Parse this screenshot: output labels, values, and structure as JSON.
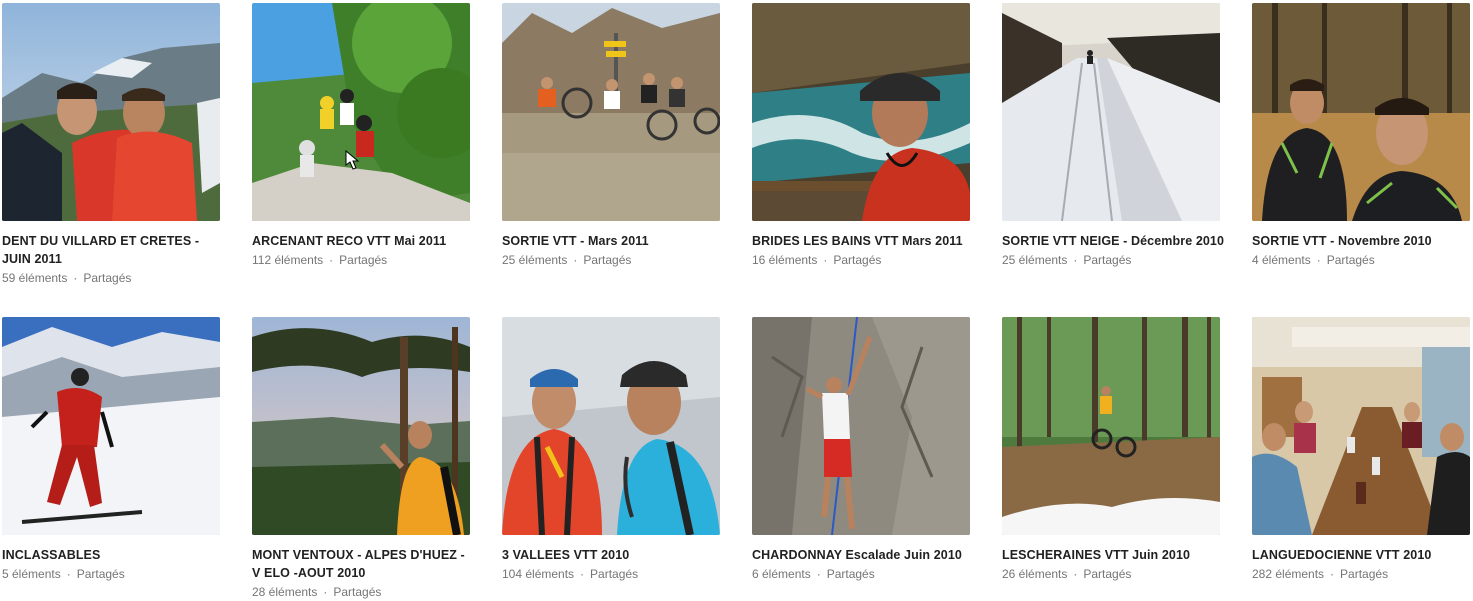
{
  "albums": [
    {
      "title": "DENT DU VILLARD ET CRETES - JUIN 2011",
      "count": "59 éléments",
      "shared": "Partagés"
    },
    {
      "title": "ARCENANT RECO VTT Mai 2011",
      "count": "112 éléments",
      "shared": "Partagés"
    },
    {
      "title": "SORTIE VTT - Mars 2011",
      "count": "25 éléments",
      "shared": "Partagés"
    },
    {
      "title": "BRIDES LES BAINS VTT Mars 2011",
      "count": "16 éléments",
      "shared": "Partagés"
    },
    {
      "title": "SORTIE VTT NEIGE - Décembre 2010",
      "count": "25 éléments",
      "shared": "Partagés"
    },
    {
      "title": "SORTIE VTT - Novembre 2010",
      "count": "4 éléments",
      "shared": "Partagés"
    },
    {
      "title": "INCLASSABLES",
      "count": "5 éléments",
      "shared": "Partagés"
    },
    {
      "title": "MONT VENTOUX - ALPES D'HUEZ - V ELO -AOUT 2010",
      "count": "28 éléments",
      "shared": "Partagés"
    },
    {
      "title": "3 VALLEES VTT 2010",
      "count": "104 éléments",
      "shared": "Partagés"
    },
    {
      "title": "CHARDONNAY Escalade Juin 2010",
      "count": "6 éléments",
      "shared": "Partagés"
    },
    {
      "title": "LESCHERAINES VTT Juin 2010",
      "count": "26 éléments",
      "shared": "Partagés"
    },
    {
      "title": "LANGUEDOCIENNE VTT 2010",
      "count": "282 éléments",
      "shared": "Partagés"
    }
  ],
  "separator": "·"
}
